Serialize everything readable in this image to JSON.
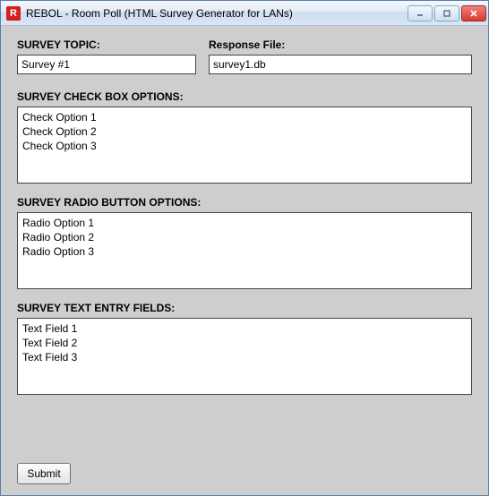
{
  "window": {
    "icon_letter": "R",
    "title": "REBOL - Room Poll (HTML Survey Generator for LANs)"
  },
  "labels": {
    "survey_topic": "SURVEY TOPIC:",
    "response_file": "Response File:",
    "checkbox_options": "SURVEY CHECK BOX OPTIONS:",
    "radio_options": "SURVEY RADIO BUTTON OPTIONS:",
    "text_fields": "SURVEY TEXT ENTRY FIELDS:",
    "submit": "Submit"
  },
  "values": {
    "survey_topic": "Survey #1",
    "response_file": "survey1.db",
    "checkbox_options": "Check Option 1\nCheck Option 2\nCheck Option 3",
    "radio_options": "Radio Option 1\nRadio Option 2\nRadio Option 3",
    "text_fields": "Text Field 1\nText Field 2\nText Field 3"
  }
}
